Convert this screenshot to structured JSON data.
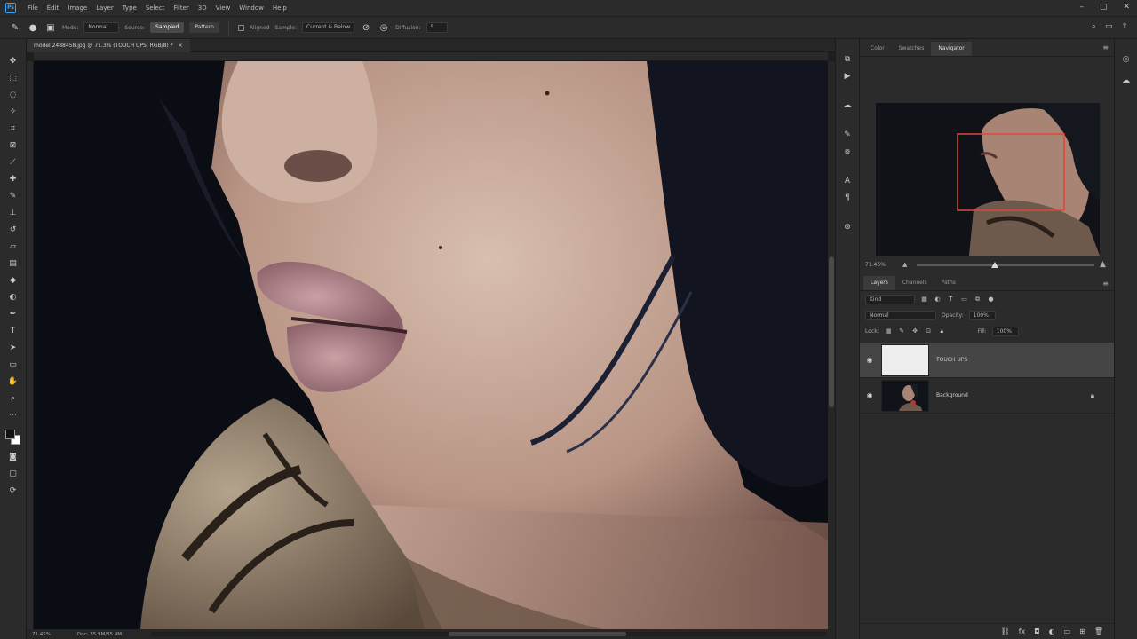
{
  "app": {
    "logo": "Ps"
  },
  "menu": [
    "File",
    "Edit",
    "Image",
    "Layer",
    "Type",
    "Select",
    "Filter",
    "3D",
    "View",
    "Window",
    "Help"
  ],
  "options": {
    "mode_label": "Mode:",
    "mode_value": "Normal",
    "source_label": "Source:",
    "source_sampled": "Sampled",
    "source_pattern": "Pattern",
    "aligned_label": "Aligned",
    "sample_label": "Sample:",
    "sample_value": "Current & Below",
    "diffusion_label": "Diffusion:",
    "diffusion_value": "5"
  },
  "document": {
    "tab_title": "model 2488458.jpg @ 71.3% (TOUCH UPS, RGB/8) *",
    "close": "×"
  },
  "status": {
    "zoom": "71.45%",
    "doc_size": "Doc: 35.9M/35.9M"
  },
  "navigator": {
    "tabs": [
      "Color",
      "Swatches",
      "Navigator"
    ],
    "active_tab": "Navigator",
    "zoom": "71.45%",
    "zoom_level": 0.44
  },
  "layers": {
    "tabs": [
      "Layers",
      "Channels",
      "Paths"
    ],
    "active_tab": "Layers",
    "filter_label": "Kind",
    "blend_mode": "Normal",
    "opacity_label": "Opacity:",
    "opacity_value": "100%",
    "lock_label": "Lock:",
    "fill_label": "Fill:",
    "fill_value": "100%",
    "items": [
      {
        "name": "TOUCH UPS",
        "selected": true,
        "thumb": "white"
      },
      {
        "name": "Background",
        "selected": false,
        "thumb": "photo",
        "locked": true
      }
    ]
  },
  "colors": {
    "accent": "#31a8ff",
    "nav_frame": "#e0473a",
    "panel_bg": "#2b2b2b"
  }
}
